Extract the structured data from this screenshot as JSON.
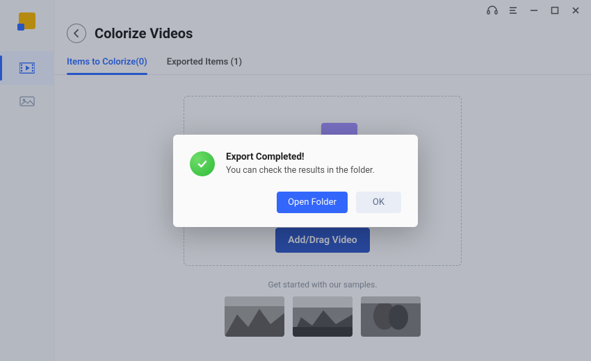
{
  "header": {
    "title": "Colorize Videos"
  },
  "tabs": {
    "items_label": "Items to Colorize(0)",
    "exported_label": "Exported Items (1)"
  },
  "dropzone": {
    "add_button_label": "Add/Drag Video"
  },
  "samples": {
    "caption": "Get started with our samples."
  },
  "dialog": {
    "title": "Export Completed!",
    "message": "You can check the results in the folder.",
    "open_folder_label": "Open Folder",
    "ok_label": "OK"
  }
}
